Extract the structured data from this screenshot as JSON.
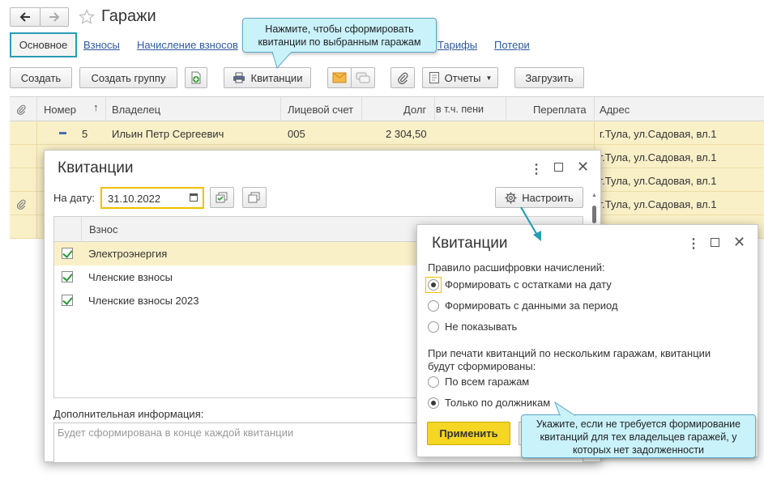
{
  "header": {
    "back_icon": "arrow-left-icon",
    "forward_icon": "arrow-right-icon",
    "star_icon": "star-icon",
    "title": "Гаражи"
  },
  "tabs": [
    {
      "label": "Основное"
    },
    {
      "label": "Взносы"
    },
    {
      "label": "Начисление взносов"
    },
    {
      "label": "Тарифы"
    },
    {
      "label": "Потери"
    }
  ],
  "toolbar": {
    "create": "Создать",
    "create_group": "Создать группу",
    "receipts": "Квитанции",
    "reports": "Отчеты",
    "load": "Загрузить"
  },
  "table": {
    "columns": [
      "Номер",
      "Владелец",
      "Лицевой счет",
      "Долг",
      "в т.ч. пени",
      "Переплата",
      "Адрес"
    ],
    "rows": [
      {
        "number": "5",
        "owner": "Ильин Петр Сергеевич",
        "account": "005",
        "debt": "2 304,50",
        "address": "г.Тула, ул.Садовая, вл.1"
      },
      {
        "address": "г.Тула, ул.Садовая, вл.1"
      },
      {
        "address": "г.Тула, ул.Садовая, вл.1"
      },
      {
        "address": "г.Тула, ул.Садовая, вл.1"
      },
      {
        "address": ""
      }
    ]
  },
  "dialog1": {
    "title": "Квитанции",
    "date_label": "На дату:",
    "date_value": "31.10.2022",
    "configure": "Настроить",
    "list_header": "Взнос",
    "items": [
      {
        "label": "Электроэнергия",
        "checked": true
      },
      {
        "label": "Членские взносы",
        "checked": true
      },
      {
        "label": "Членские взносы 2023",
        "checked": true
      }
    ],
    "extra_label": "Дополнительная информация:",
    "extra_placeholder": "Будет сформирована в конце каждой квитанции"
  },
  "dialog2": {
    "title": "Квитанции",
    "rule_label": "Правило расшифровки начислений:",
    "rule_options": [
      {
        "label": "Формировать с остатками на дату",
        "selected": true
      },
      {
        "label": "Формировать с данными за период",
        "selected": false
      },
      {
        "label": "Не показывать",
        "selected": false
      }
    ],
    "print_label_1": "При печати квитанций по нескольким гаражам, квитанции",
    "print_label_2": "будут сформированы:",
    "print_options": [
      {
        "label": "По всем гаражам",
        "selected": false
      },
      {
        "label": "Только по должникам",
        "selected": true
      }
    ],
    "apply": "Применить"
  },
  "tooltips": {
    "top_line1": "Нажмите, чтобы сформировать",
    "top_line2": "квитанции по выбранным гаражам",
    "bottom_line1": "Укажите, если не требуется формирование",
    "bottom_line2": "квитанций для тех владельцев гаражей, у",
    "bottom_line3": "которых нет задолженности"
  },
  "colors": {
    "accent": "#2a9cb5",
    "row_highlight": "#faf0c8",
    "apply_button": "#f5d622",
    "date_border": "#f0c000",
    "tooltip_bg": "#c9f2fb"
  }
}
